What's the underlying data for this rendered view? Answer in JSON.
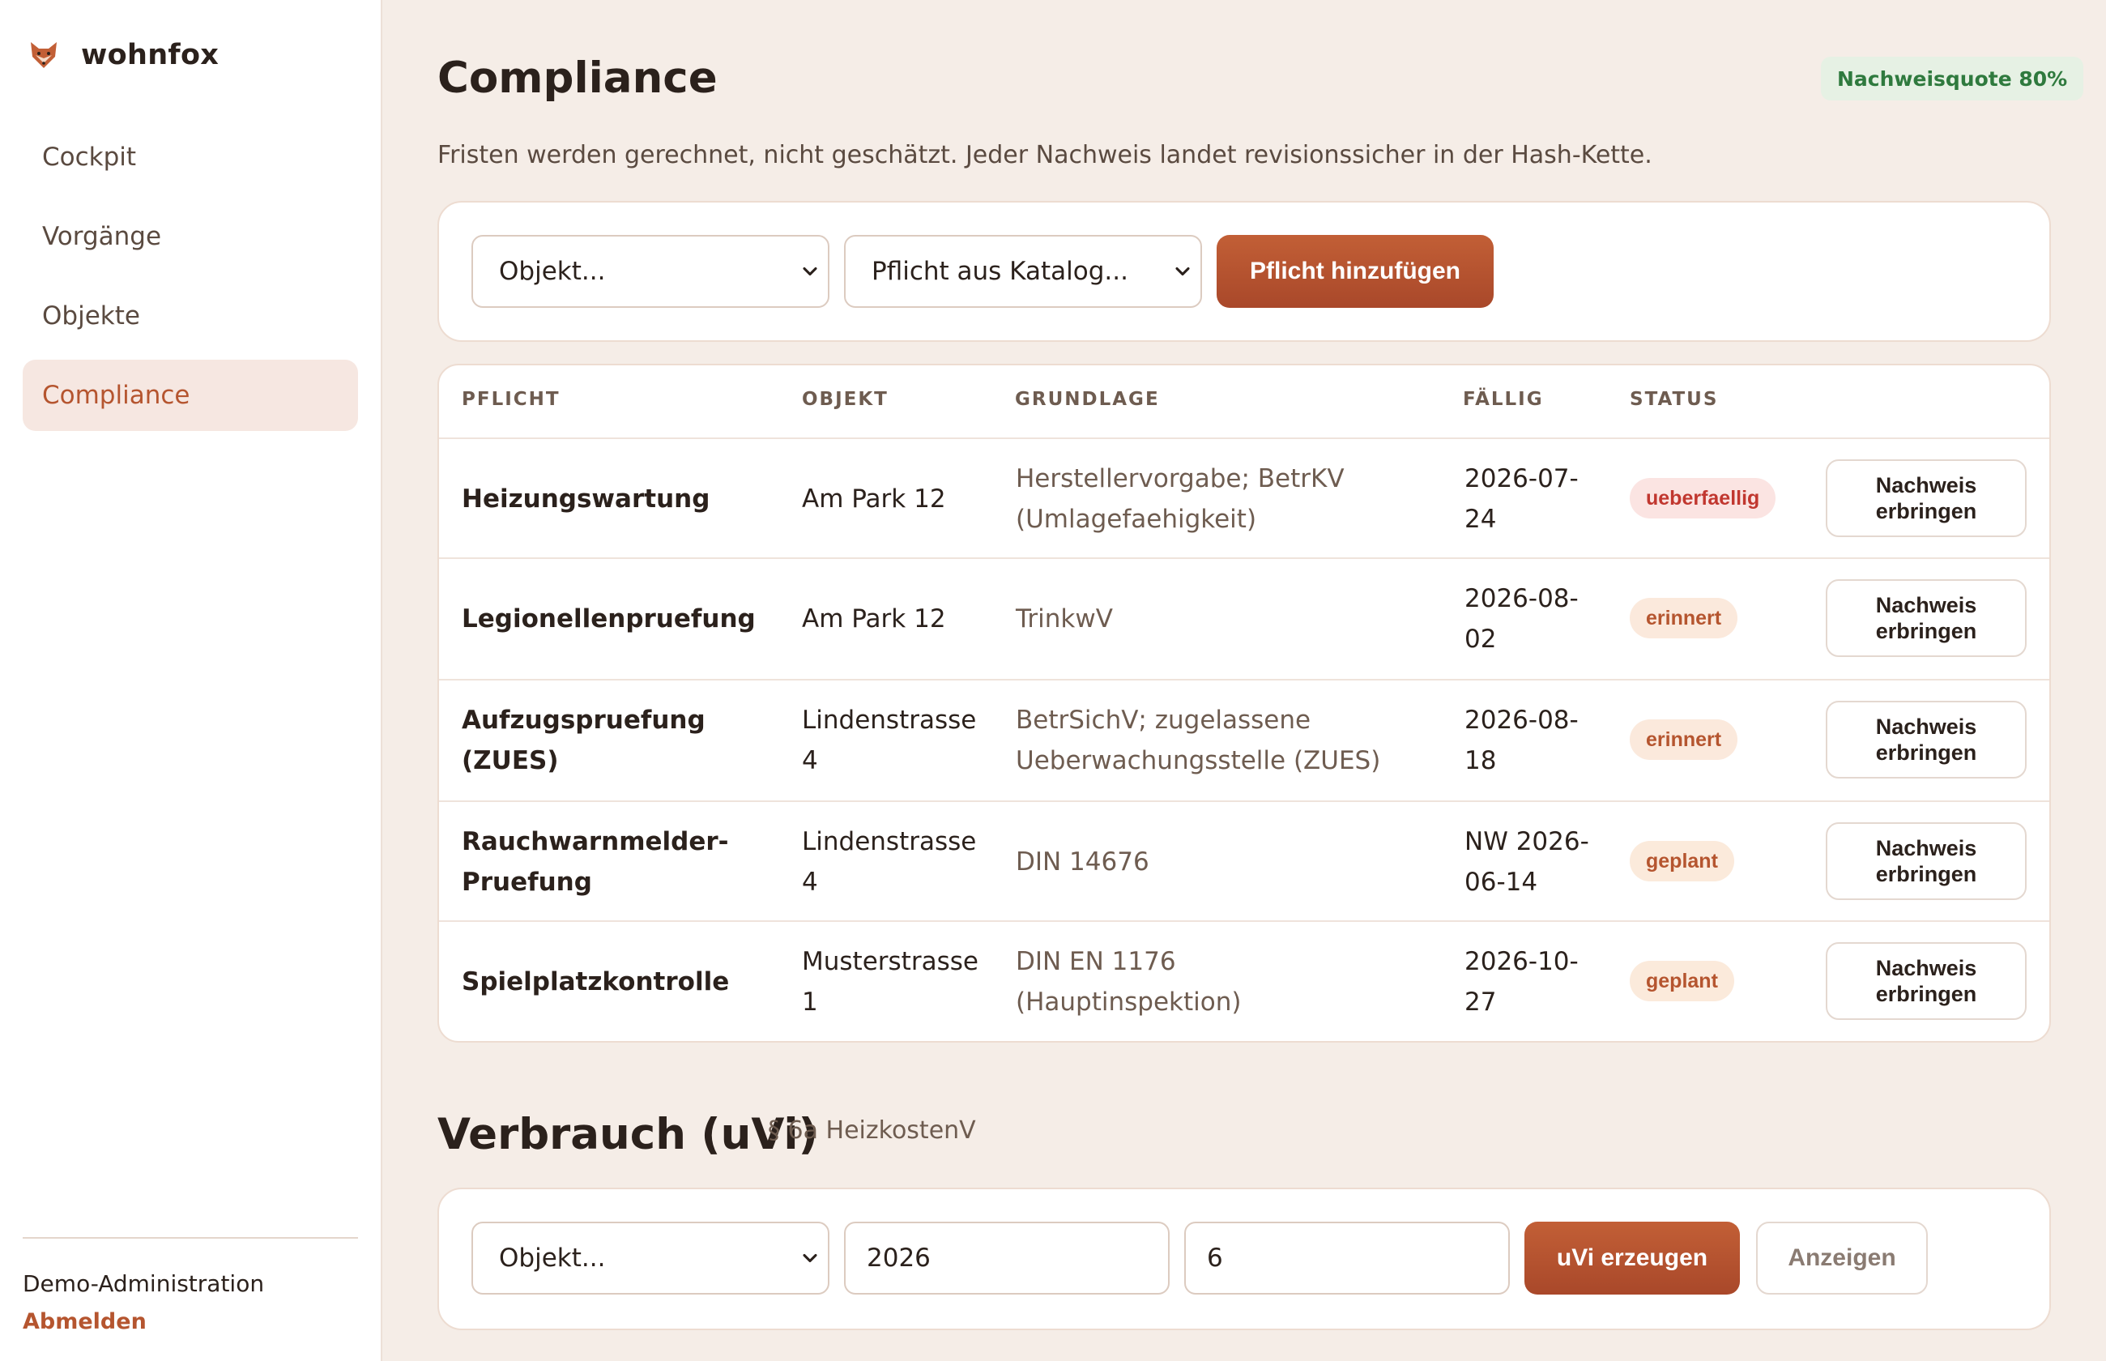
{
  "brand": {
    "name": "wohnfox",
    "logo_icon": "fox-icon"
  },
  "sidebar": {
    "items": [
      {
        "label": "Cockpit",
        "active": false
      },
      {
        "label": "Vorgänge",
        "active": false
      },
      {
        "label": "Objekte",
        "active": false
      },
      {
        "label": "Compliance",
        "active": true
      }
    ],
    "user": "Demo-Administration",
    "logout": "Abmelden"
  },
  "header": {
    "title": "Compliance",
    "quota_badge": "Nachweisquote 80%",
    "subtitle": "Fristen werden gerechnet, nicht geschätzt. Jeder Nachweis landet revisionssicher in der Hash-Kette."
  },
  "add_form": {
    "object_select": "Objekt...",
    "catalog_select": "Pflicht aus Katalog...",
    "add_button": "Pflicht hinzufügen"
  },
  "table": {
    "columns": [
      "PFLICHT",
      "OBJEKT",
      "GRUNDLAGE",
      "FÄLLIG",
      "STATUS"
    ],
    "rows": [
      {
        "pflicht": "Heizungswartung",
        "objekt": "Am Park 12",
        "grundlage": "Herstellervorgabe; BetrKV (Umlagefaehigkeit)",
        "faellig": "2026-07-24",
        "status": "ueberfaellig",
        "action": "Nachweis erbringen"
      },
      {
        "pflicht": "Legionellenpruefung",
        "objekt": "Am Park 12",
        "grundlage": "TrinkwV",
        "faellig": "2026-08-02",
        "status": "erinnert",
        "action": "Nachweis erbringen"
      },
      {
        "pflicht": "Aufzugspruefung (ZUES)",
        "objekt": "Lindenstrasse 4",
        "grundlage": "BetrSichV; zugelassene Ueberwachungsstelle (ZUES)",
        "faellig": "2026-08-18",
        "status": "erinnert",
        "action": "Nachweis erbringen"
      },
      {
        "pflicht": "Rauchwarnmelder-Pruefung",
        "objekt": "Lindenstrasse 4",
        "grundlage": "DIN 14676",
        "faellig": "NW 2026-06-14",
        "status": "geplant",
        "action": "Nachweis erbringen"
      },
      {
        "pflicht": "Spielplatzkontrolle",
        "objekt": "Musterstrasse 1",
        "grundlage": "DIN EN 1176 (Hauptinspektion)",
        "faellig": "2026-10-27",
        "status": "geplant",
        "action": "Nachweis erbringen"
      }
    ]
  },
  "uvi": {
    "title": "Verbrauch (uVi)",
    "subtitle": "§ 6a HeizkostenV",
    "object_select": "Objekt...",
    "year_value": "2026",
    "month_value": "6",
    "generate_button": "uVi erzeugen",
    "show_button": "Anzeigen"
  },
  "colors": {
    "accent": "#b5552f",
    "background": "#f5ede7",
    "status_overdue": "#c1372f",
    "status_ok": "#2f7a3e"
  }
}
